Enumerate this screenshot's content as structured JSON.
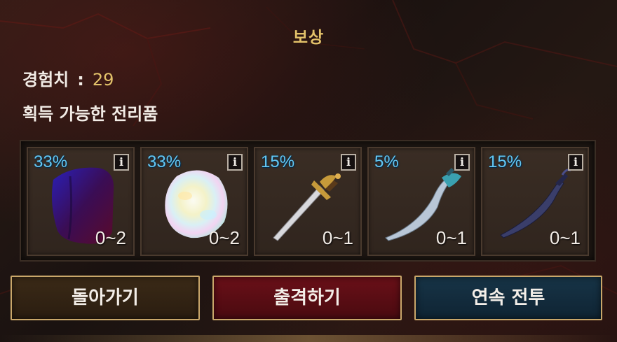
{
  "title": "보상",
  "experience": {
    "label": "경험치",
    "separator": ":",
    "value": "29"
  },
  "loot_label": "획득 가능한 전리품",
  "slots": [
    {
      "chance": "33%",
      "qty": "0~2",
      "info": "i",
      "icon": "dark-cloth-icon"
    },
    {
      "chance": "33%",
      "qty": "0~2",
      "info": "i",
      "icon": "opal-gem-icon"
    },
    {
      "chance": "15%",
      "qty": "0~1",
      "info": "i",
      "icon": "golden-sword-icon"
    },
    {
      "chance": "5%",
      "qty": "0~1",
      "info": "i",
      "icon": "curved-blade-icon"
    },
    {
      "chance": "15%",
      "qty": "0~1",
      "info": "i",
      "icon": "dark-scimitar-icon"
    }
  ],
  "buttons": {
    "back": "돌아가기",
    "sortie": "출격하기",
    "continuous": "연속 전투"
  },
  "colors": {
    "accent_gold": "#e3c26a",
    "chance_blue": "#63c7f3",
    "sortie_red": "#6a1018",
    "continuous_blue": "#173447"
  }
}
